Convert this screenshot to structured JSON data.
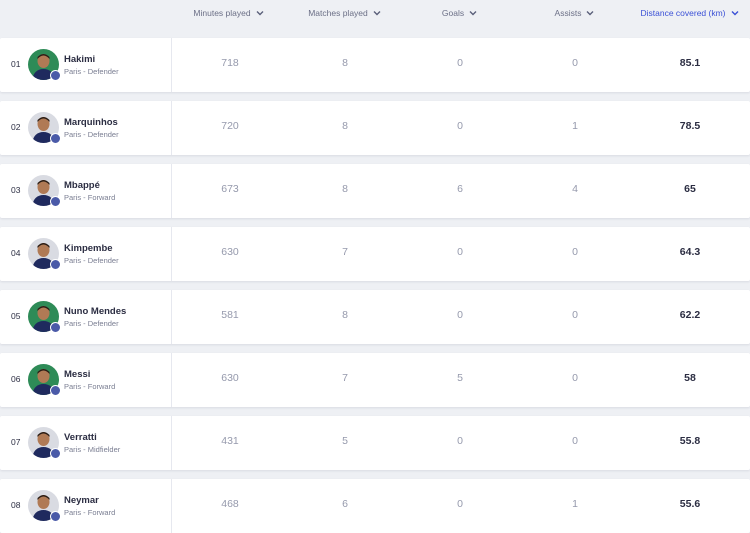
{
  "columns": [
    {
      "label": "Minutes played"
    },
    {
      "label": "Matches played"
    },
    {
      "label": "Goals"
    },
    {
      "label": "Assists"
    },
    {
      "label": "Distance covered (km)"
    }
  ],
  "colors": {
    "accent": "#3a50d6",
    "text_dark": "#2b2d42",
    "text_muted": "#9599ac",
    "club_badge": "#4a5aa8",
    "avatar_green": "#2e8b57",
    "avatar_grey": "#d9dbe2"
  },
  "players": [
    {
      "rank": "01",
      "name": "Hakimi",
      "meta": "Paris - Defender",
      "minutes": "718",
      "matches": "8",
      "goals": "0",
      "assists": "0",
      "distance": "85.1",
      "avatar_bg": "green"
    },
    {
      "rank": "02",
      "name": "Marquinhos",
      "meta": "Paris - Defender",
      "minutes": "720",
      "matches": "8",
      "goals": "0",
      "assists": "1",
      "distance": "78.5",
      "avatar_bg": "grey"
    },
    {
      "rank": "03",
      "name": "Mbappé",
      "meta": "Paris - Forward",
      "minutes": "673",
      "matches": "8",
      "goals": "6",
      "assists": "4",
      "distance": "65",
      "avatar_bg": "grey"
    },
    {
      "rank": "04",
      "name": "Kimpembe",
      "meta": "Paris - Defender",
      "minutes": "630",
      "matches": "7",
      "goals": "0",
      "assists": "0",
      "distance": "64.3",
      "avatar_bg": "grey"
    },
    {
      "rank": "05",
      "name": "Nuno Mendes",
      "meta": "Paris - Defender",
      "minutes": "581",
      "matches": "8",
      "goals": "0",
      "assists": "0",
      "distance": "62.2",
      "avatar_bg": "green"
    },
    {
      "rank": "06",
      "name": "Messi",
      "meta": "Paris - Forward",
      "minutes": "630",
      "matches": "7",
      "goals": "5",
      "assists": "0",
      "distance": "58",
      "avatar_bg": "green"
    },
    {
      "rank": "07",
      "name": "Verratti",
      "meta": "Paris - Midfielder",
      "minutes": "431",
      "matches": "5",
      "goals": "0",
      "assists": "0",
      "distance": "55.8",
      "avatar_bg": "grey"
    },
    {
      "rank": "08",
      "name": "Neymar",
      "meta": "Paris - Forward",
      "minutes": "468",
      "matches": "6",
      "goals": "0",
      "assists": "1",
      "distance": "55.6",
      "avatar_bg": "grey"
    }
  ]
}
